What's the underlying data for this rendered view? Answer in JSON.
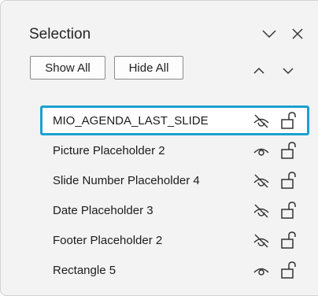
{
  "pane": {
    "title": "Selection",
    "collapse_icon": "chevron-down-icon",
    "close_icon": "close-icon"
  },
  "toolbar": {
    "show_all_label": "Show All",
    "hide_all_label": "Hide All",
    "bring_forward_icon": "chevron-up-icon",
    "send_backward_icon": "chevron-down-icon"
  },
  "items": [
    {
      "label": "MIO_AGENDA_LAST_SLIDE",
      "visible": false,
      "selected": true
    },
    {
      "label": "Picture Placeholder 2",
      "visible": true,
      "selected": false
    },
    {
      "label": "Slide Number Placeholder 4",
      "visible": false,
      "selected": false
    },
    {
      "label": "Date Placeholder 3",
      "visible": false,
      "selected": false
    },
    {
      "label": "Footer Placeholder 2",
      "visible": false,
      "selected": false
    },
    {
      "label": "Rectangle 5",
      "visible": true,
      "selected": false
    }
  ],
  "colors": {
    "pane_background": "#f3f3f3",
    "selection_border": "#1ba1d0",
    "text": "#1c1c1c"
  }
}
